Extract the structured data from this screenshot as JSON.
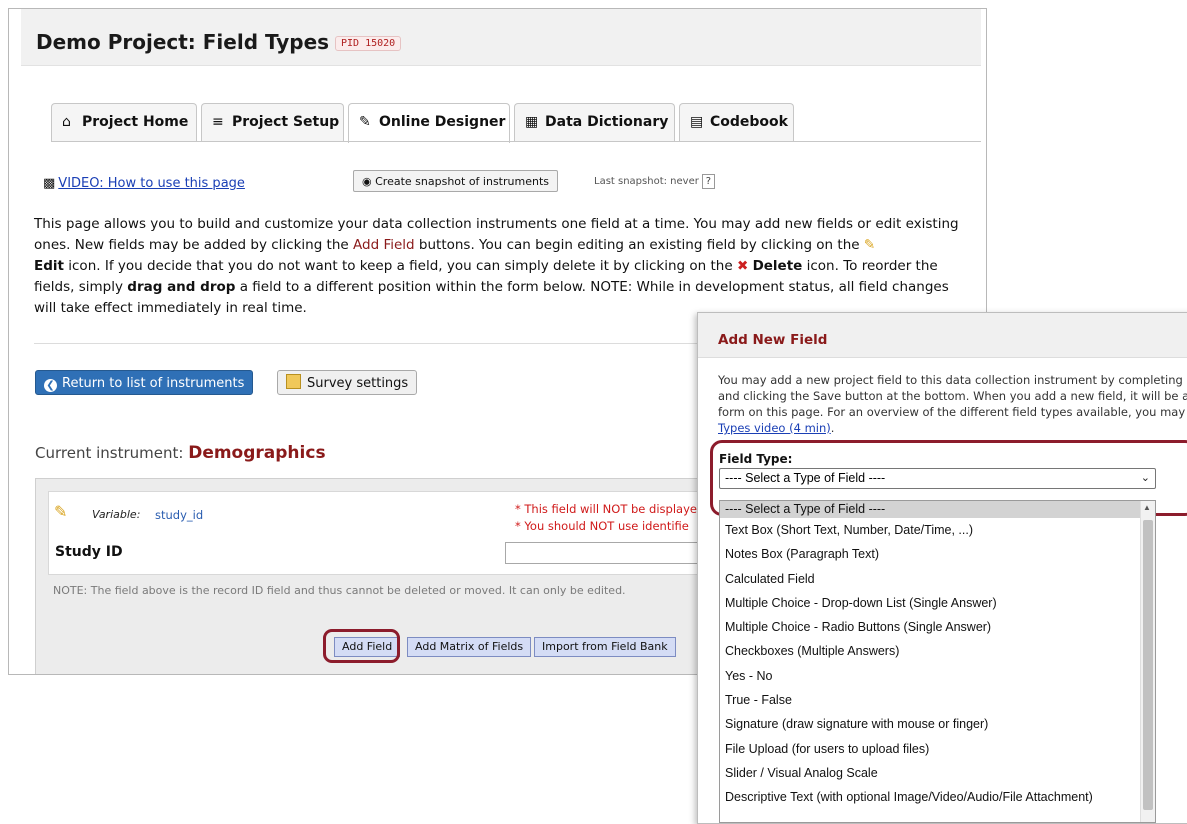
{
  "project": {
    "title": "Demo Project: Field Types",
    "pid": "PID 15020"
  },
  "tabs": [
    {
      "label": "Project Home",
      "icon": "home-icon"
    },
    {
      "label": "Project Setup",
      "icon": "checklist-icon"
    },
    {
      "label": "Online Designer",
      "icon": "edit-icon"
    },
    {
      "label": "Data Dictionary",
      "icon": "excel-icon"
    },
    {
      "label": "Codebook",
      "icon": "book-icon"
    }
  ],
  "toolbar": {
    "video_link": "VIDEO: How to use this page",
    "snapshot_button": "Create snapshot of instruments",
    "last_snapshot": "Last snapshot: never",
    "help_mark": "?"
  },
  "intro": {
    "p1": "This page allows you to build and customize your data collection instruments one field at a time. You may add new fields or edit existing ones. New fields may be added by clicking the ",
    "add_field": "Add Field",
    "p2": " buttons. You can begin editing an existing field by clicking on the ",
    "edit": "Edit",
    "p3": " icon. If you decide that you do not want to keep a field, you can simply delete it by clicking on the ",
    "delete": "Delete",
    "p4": " icon. To reorder the fields, simply ",
    "drag": "drag and drop",
    "p5": " a field to a different position within the form below. NOTE: While in development status, all field changes will take effect immediately in real time."
  },
  "nav": {
    "return_button": "Return to list of instruments",
    "survey_button": "Survey settings"
  },
  "instrument": {
    "label": "Current instrument: ",
    "name": "Demographics"
  },
  "field": {
    "variable_label": "Variable:",
    "variable_name": "study_id",
    "warning1": "* This field will NOT be displaye",
    "warning2": "* You should NOT use identifie",
    "label": "Study ID",
    "note": "NOTE: The field above is the record ID field and thus cannot be deleted or moved. It can only be edited."
  },
  "buttons": {
    "add_field": "Add Field",
    "add_matrix": "Add Matrix of Fields",
    "import_bank": "Import from Field Bank"
  },
  "dialog": {
    "title": "Add New Field",
    "desc1": "You may add a new project field to this data collection instrument by completing",
    "desc2": "and clicking the Save button at the bottom. When you add a new field, it will be a",
    "desc3": "form on this page. For an overview of the different field types available, you may",
    "desc_link": "Types video (4 min)",
    "desc_end": ".",
    "field_type_label": "Field Type:",
    "select_value": "---- Select a Type of Field ----",
    "options": [
      "---- Select a Type of Field ----",
      "Text Box (Short Text, Number, Date/Time, ...)",
      "Notes Box (Paragraph Text)",
      "Calculated Field",
      "Multiple Choice - Drop-down List (Single Answer)",
      "Multiple Choice - Radio Buttons (Single Answer)",
      "Checkboxes (Multiple Answers)",
      "Yes - No",
      "True - False",
      "Signature (draw signature with mouse or finger)",
      "File Upload (for users to upload files)",
      "Slider / Visual Analog Scale",
      "Descriptive Text (with optional Image/Video/Audio/File Attachment)"
    ]
  },
  "colors": {
    "accent_red": "#8a1a1a",
    "highlight_ring": "#8c1c2c",
    "primary_blue": "#2f70b6",
    "link_blue": "#1a3fb5"
  }
}
